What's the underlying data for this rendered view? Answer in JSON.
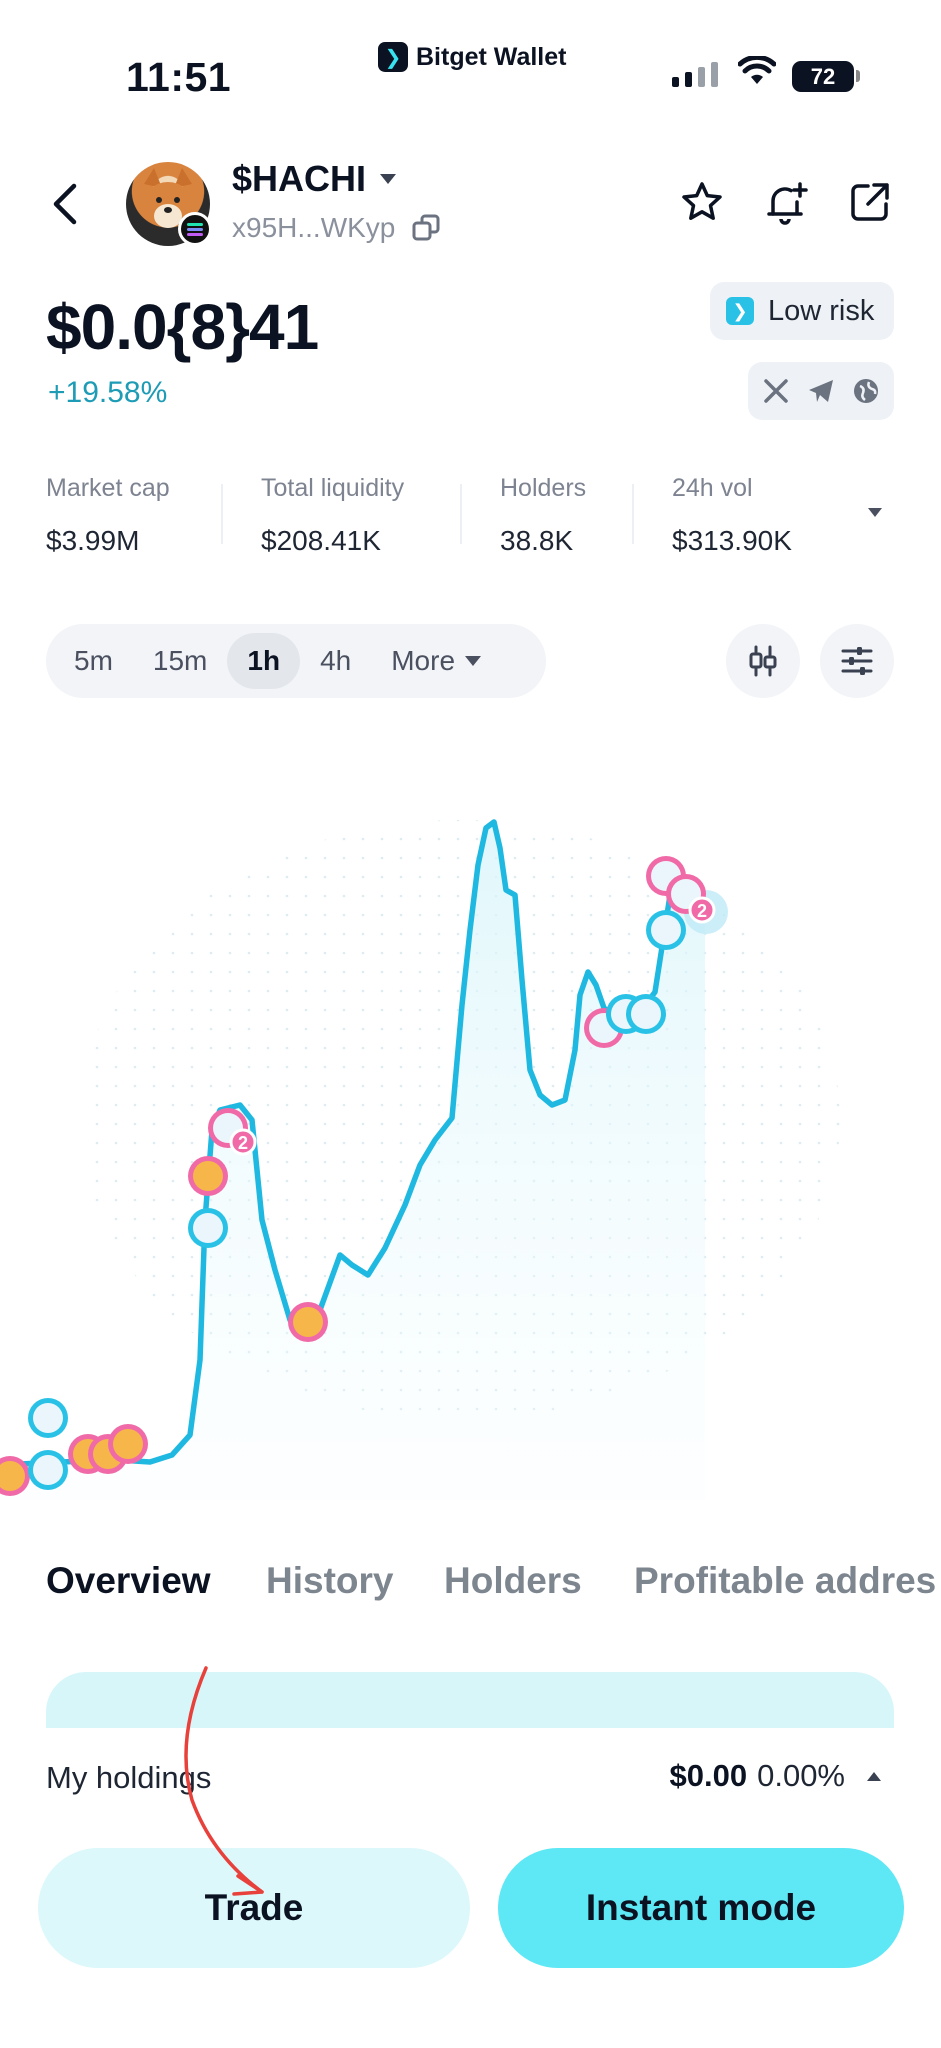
{
  "status_bar": {
    "time": "11:51",
    "app_brand": "Bitget Wallet",
    "battery": "72"
  },
  "token": {
    "name": "$HACHI",
    "address": "x95H...WKyp",
    "price": "$0.0{8}41",
    "change": "+19.58%",
    "risk_label": "Low risk",
    "social_icons": [
      "x-icon",
      "telegram-icon",
      "globe-icon"
    ]
  },
  "stats": [
    {
      "label": "Market cap",
      "value": "$3.99M"
    },
    {
      "label": "Total liquidity",
      "value": "$208.41K"
    },
    {
      "label": "Holders",
      "value": "38.8K"
    },
    {
      "label": "24h vol",
      "value": "$313.90K"
    }
  ],
  "intervals": [
    "5m",
    "15m",
    "1h",
    "4h",
    "More"
  ],
  "active_interval": "1h",
  "marker_counts": [
    "2",
    "2"
  ],
  "tabs": [
    "Overview",
    "History",
    "Holders",
    "Profitable addres"
  ],
  "active_tab": "Overview",
  "holdings": {
    "label": "My holdings",
    "value": "$0.00",
    "percent": "0.00%"
  },
  "buttons": {
    "trade": "Trade",
    "instant": "Instant mode"
  },
  "colors": {
    "accent": "#29c2e6",
    "line": "#1fb8e0",
    "sell_marker": "#f06aa8",
    "buy_marker": "#29c2e6"
  }
}
